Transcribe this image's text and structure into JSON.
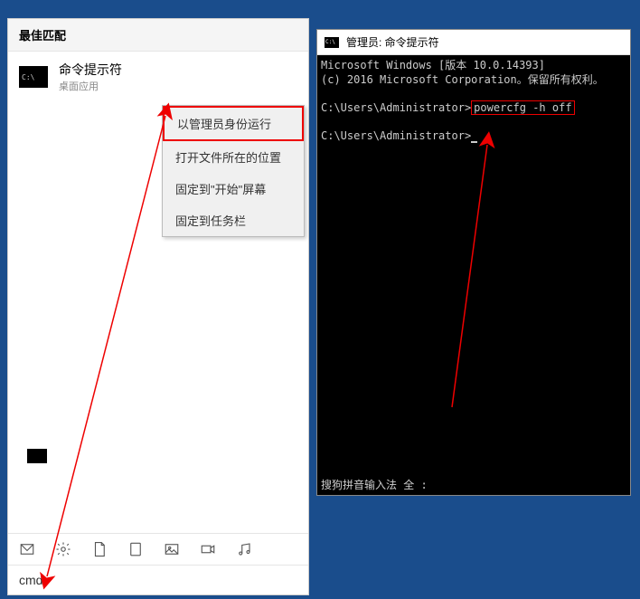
{
  "start_menu": {
    "header": "最佳匹配",
    "result": {
      "title": "命令提示符",
      "subtitle": "桌面应用",
      "icon_text": "C:\\"
    },
    "context_menu": {
      "items": [
        "以管理员身份运行",
        "打开文件所在的位置",
        "固定到\"开始\"屏幕",
        "固定到任务栏"
      ]
    },
    "search_value": "cmd"
  },
  "cmd_window": {
    "title": "管理员: 命令提示符",
    "icon_text": "C:\\",
    "line1": "Microsoft Windows [版本 10.0.14393]",
    "line2": "(c) 2016 Microsoft Corporation。保留所有权利。",
    "prompt1_path": "C:\\Users\\Administrator>",
    "command": "powercfg -h off",
    "prompt2_path": "C:\\Users\\Administrator>",
    "ime": "搜狗拼音输入法 全 :"
  }
}
